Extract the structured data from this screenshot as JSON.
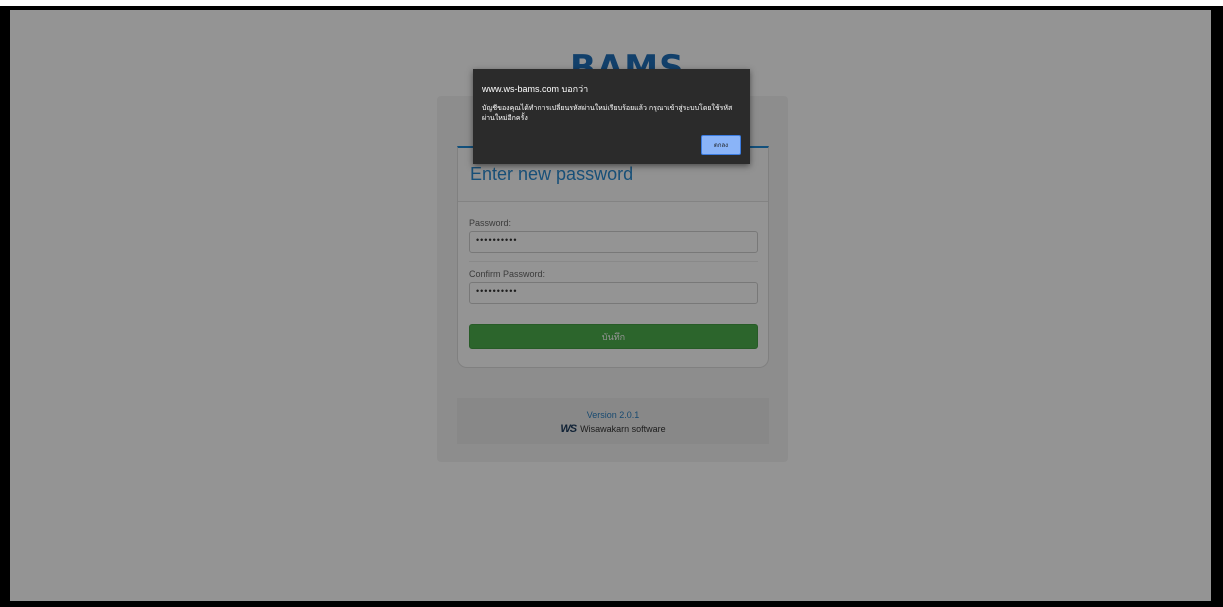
{
  "logo": {
    "text": "BAMS"
  },
  "form": {
    "title": "Enter new password",
    "password_label": "Password:",
    "password_value": "••••••••••",
    "confirm_label": "Confirm Password:",
    "confirm_value": "••••••••••",
    "save_label": "บันทึก"
  },
  "footer": {
    "version": "Version 2.0.1",
    "brand_mark": "WS",
    "brand_name": "Wisawakarn software"
  },
  "dialog": {
    "title": "www.ws-bams.com บอกว่า",
    "message": "บัญชีของคุณได้ทำการเปลี่ยนรหัสผ่านใหม่เรียบร้อยแล้ว กรุณาเข้าสู่ระบบโดยใช้รหัสผ่านใหม่อีกครั้ง",
    "ok_label": "ตกลง"
  },
  "colors": {
    "accent": "#1f8ad6",
    "save_button": "#4cae4c",
    "dialog_bg": "#2b2b2b",
    "dialog_button": "#8ab4f8"
  }
}
